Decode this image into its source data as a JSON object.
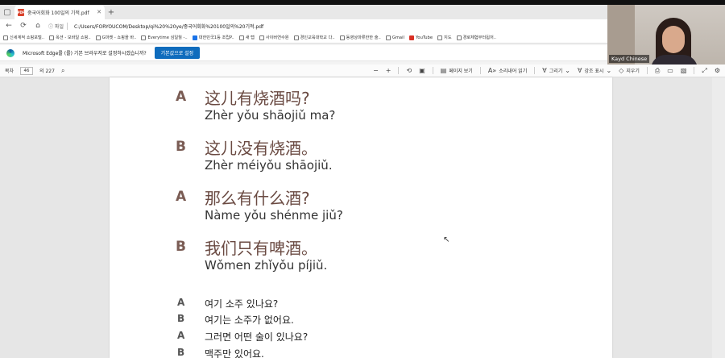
{
  "browser": {
    "tab_title": "중국어회화 100일의 기적.pdf",
    "address_label": "파일",
    "url": "C:/Users/FORYOUCOM/Desktop/qi%20%20ye/중국어회화%20100일의%20기적.pdf"
  },
  "bookmarks": [
    {
      "label": "신세계적 쇼핑포털..",
      "icon": "box"
    },
    {
      "label": "옥션 - 모바일 쇼핑..",
      "icon": "page"
    },
    {
      "label": "G마켓 - 쇼핑을 바..",
      "icon": "page"
    },
    {
      "label": "Everytime 심일월 -..",
      "icon": "page"
    },
    {
      "label": "대한민국1등 조립P..",
      "icon": "blue"
    },
    {
      "label": "새 탭",
      "icon": "box"
    },
    {
      "label": "사이버연수원",
      "icon": "page"
    },
    {
      "label": "경인교육대학교 다..",
      "icon": "page"
    },
    {
      "label": "동영상마류한한 술..",
      "icon": "page"
    },
    {
      "label": "Gmail",
      "icon": "page"
    },
    {
      "label": "YouTube",
      "icon": "red"
    },
    {
      "label": "지도",
      "icon": "page"
    },
    {
      "label": "경로체험부터됩저..",
      "icon": "page"
    }
  ],
  "banner": {
    "text": "Microsoft Edge를 (를) 기본 브라우저로 설정하시겠습니까?",
    "button_label": "기본값으로 설정"
  },
  "pdf_toolbar": {
    "toc_label": "목차",
    "current_page": "46",
    "total_pages": "의 227",
    "page_view_label": "페이지 보기",
    "read_aloud_label": "소리내어 읽기",
    "draw_label": "그리기",
    "highlight_label": "강조 표시",
    "erase_label": "지우기",
    "minus": "−",
    "plus": "+"
  },
  "dialogue": [
    {
      "speaker": "A",
      "hanzi": "这儿有烧酒吗?",
      "pinyin": "Zhèr yǒu shāojiǔ ma?"
    },
    {
      "speaker": "B",
      "hanzi": "这儿没有烧酒。",
      "pinyin": "Zhèr méiyǒu shāojiǔ."
    },
    {
      "speaker": "A",
      "hanzi": "那么有什么酒?",
      "pinyin": "Nàme yǒu shénme jiǔ?"
    },
    {
      "speaker": "B",
      "hanzi": "我们只有啤酒。",
      "pinyin": "Wǒmen zhǐyǒu píjiǔ."
    }
  ],
  "korean": [
    {
      "speaker": "A",
      "text": "여기 소주 있나요?"
    },
    {
      "speaker": "B",
      "text": "여기는 소주가 없어요."
    },
    {
      "speaker": "A",
      "text": "그러면 어떤 술이 있나요?"
    },
    {
      "speaker": "B",
      "text": "맥주만 있어요."
    }
  ],
  "webcam": {
    "name": "Kayd Chinese"
  }
}
